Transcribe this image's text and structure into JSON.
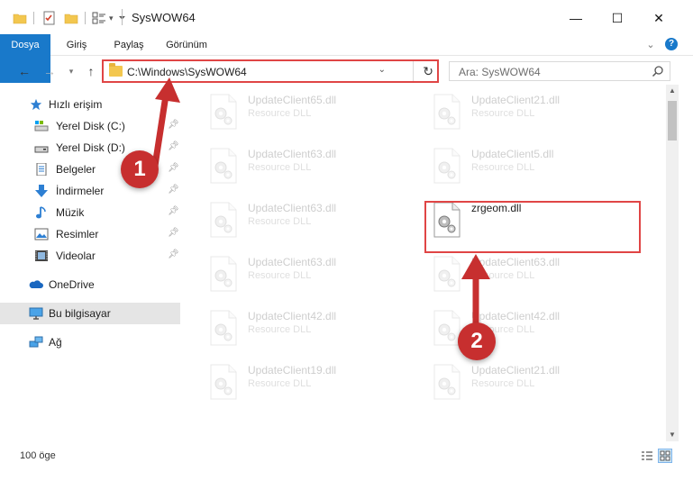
{
  "window": {
    "title": "SysWOW64",
    "minimize": "—",
    "maximize": "☐",
    "close": "✕"
  },
  "ribbon": {
    "tabs": [
      "Dosya",
      "Giriş",
      "Paylaş",
      "Görünüm"
    ],
    "expand": "⌄",
    "help": "?"
  },
  "address": {
    "path": "C:\\Windows\\SysWOW64",
    "search_placeholder": "Ara: SysWOW64"
  },
  "sidebar": {
    "quick_access": "Hızlı erişim",
    "items": [
      {
        "label": "Yerel Disk (C:)",
        "icon": "drive-icon"
      },
      {
        "label": "Yerel Disk (D:)",
        "icon": "drive-icon"
      },
      {
        "label": "Belgeler",
        "icon": "documents-icon"
      },
      {
        "label": "İndirmeler",
        "icon": "downloads-icon"
      },
      {
        "label": "Müzik",
        "icon": "music-icon"
      },
      {
        "label": "Resimler",
        "icon": "pictures-icon"
      },
      {
        "label": "Videolar",
        "icon": "videos-icon"
      }
    ],
    "onedrive": "OneDrive",
    "this_pc": "Bu bilgisayar",
    "network": "Ağ"
  },
  "files": {
    "left_column": [
      {
        "name": "UpdateClient65.dll",
        "desc": "Resource DLL"
      },
      {
        "name": "UpdateClient63.dll",
        "desc": "Resource DLL"
      },
      {
        "name": "UpdateClient63.dll",
        "desc": "Resource DLL"
      },
      {
        "name": "UpdateClient63.dll",
        "desc": "Resource DLL"
      },
      {
        "name": "UpdateClient42.dll",
        "desc": "Resource DLL"
      },
      {
        "name": "UpdateClient19.dll",
        "desc": "Resource DLL"
      }
    ],
    "right_column": [
      {
        "name": "UpdateClient21.dll",
        "desc": "Resource DLL"
      },
      {
        "name": "UpdateClient5.dll",
        "desc": "Resource DLL"
      },
      {
        "name": "zrgeom.dll",
        "desc": ""
      },
      {
        "name": "UpdateClient63.dll",
        "desc": "Resource DLL"
      },
      {
        "name": "UpdateClient42.dll",
        "desc": "Resource DLL"
      },
      {
        "name": "UpdateClient21.dll",
        "desc": "Resource DLL"
      }
    ]
  },
  "status": {
    "item_count": "100 öge"
  },
  "callouts": {
    "step1": "1",
    "step2": "2"
  },
  "colors": {
    "accent": "#1979ca",
    "highlight": "#e04545",
    "badge": "#c72f2f"
  }
}
